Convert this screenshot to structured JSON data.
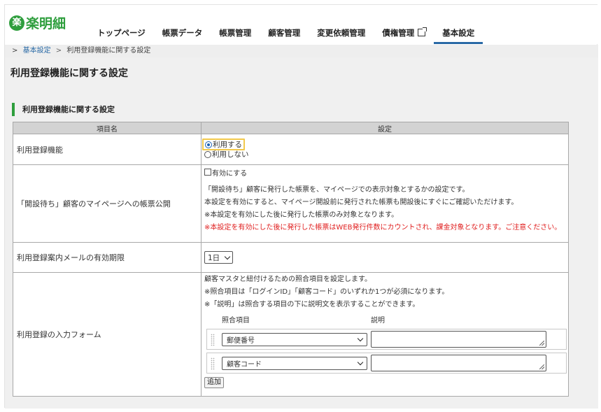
{
  "app": {
    "logo_mark": "楽",
    "logo_text": "楽明細"
  },
  "nav": {
    "items": [
      {
        "label": "トップページ"
      },
      {
        "label": "帳票データ"
      },
      {
        "label": "帳票管理"
      },
      {
        "label": "顧客管理"
      },
      {
        "label": "変更依頼管理"
      },
      {
        "label": "債権管理"
      },
      {
        "label": "基本設定"
      }
    ],
    "active": "基本設定",
    "external_icon": "external-link-icon"
  },
  "breadcrumb": {
    "prefix": ">",
    "parent": "基本設定",
    "separator": ">",
    "current": "利用登録機能に関する設定"
  },
  "page": {
    "title": "利用登録機能に関する設定",
    "section_title": "利用登録機能に関する設定"
  },
  "table": {
    "headers": {
      "item": "項目名",
      "setting": "設定"
    },
    "rows": {
      "registration": {
        "label": "利用登録機能",
        "options": [
          "利用する",
          "利用しない"
        ],
        "selected": "利用する"
      },
      "pending": {
        "label": "「開設待ち」顧客のマイページへの帳票公開",
        "checkbox_label": "有効にする",
        "checked": false,
        "descriptions": [
          "「開設待ち」顧客に発行した帳票を、マイページでの表示対象とするかの設定です。",
          "本設定を有効にすると、マイページ開設前に発行された帳票も開設後にすぐにご確認いただけます。",
          "※本設定を有効にした後に発行した帳票のみ対象となります。"
        ],
        "warning": "※本設定を有効にした後に発行した帳票はWEB発行件数にカウントされ、課金対象となります。ご注意ください。"
      },
      "mail_expiry": {
        "label": "利用登録案内メールの有効期限",
        "value": "1日"
      },
      "input_form": {
        "label": "利用登録の入力フォーム",
        "descriptions": [
          "顧客マスタと紐付けるための照合項目を設定します。",
          "※照合項目は「ログインID」「顧客コード」のいずれか1つが必須になります。",
          "※「説明」は照合する項目の下に説明文を表示することができます。"
        ],
        "col_match": "照合項目",
        "col_desc": "説明",
        "fields": [
          {
            "match": "郵便番号",
            "desc": ""
          },
          {
            "match": "顧客コード",
            "desc": ""
          }
        ],
        "add_label": "追加"
      }
    }
  },
  "colors": {
    "brand_green": "#2e9e3d",
    "active_underline": "#2a6aa6",
    "warning_red": "#e02020",
    "focus_outline": "#f2c94c"
  }
}
